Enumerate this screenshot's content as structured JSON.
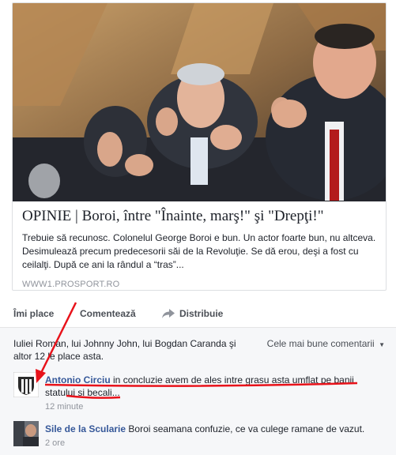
{
  "post": {
    "link_title": "OPINIE | Boroi, între \"Înainte, marş!\" şi \"Drepţi!\"",
    "link_description": "Trebuie să recunosc. Colonelul George Boroi e bun. Un actor foarte bun, nu altceva. Desimulează precum predecesorii săi de la Revoluţie. Se dă erou, deşi a fost cu ceilalţi. După ce ani la rândul a “tras”...",
    "link_domain": "WWW1.PROSPORT.RO"
  },
  "actions": {
    "like": "Îmi place",
    "comment": "Comentează",
    "share": "Distribuie"
  },
  "likes_summary": "Iuliei Roman, lui Johnny John, lui Bogdan Caranda şi altor 12 le place asta.",
  "sort": {
    "label": "Cele mai bune comentarii"
  },
  "comments": [
    {
      "author": "Antonio Circiu",
      "text": "in concluzie avem de ales intre grasu asta umflat pe banii statului si becali...",
      "time": "12 minute"
    },
    {
      "author": "Sile de la Scularie",
      "text": "Boroi seamana confuzie, ce va culege ramane de vazut.",
      "time": "2 ore"
    }
  ],
  "colors": {
    "link": "#365899",
    "annotation": "#e8121a",
    "muted": "#90949c"
  }
}
